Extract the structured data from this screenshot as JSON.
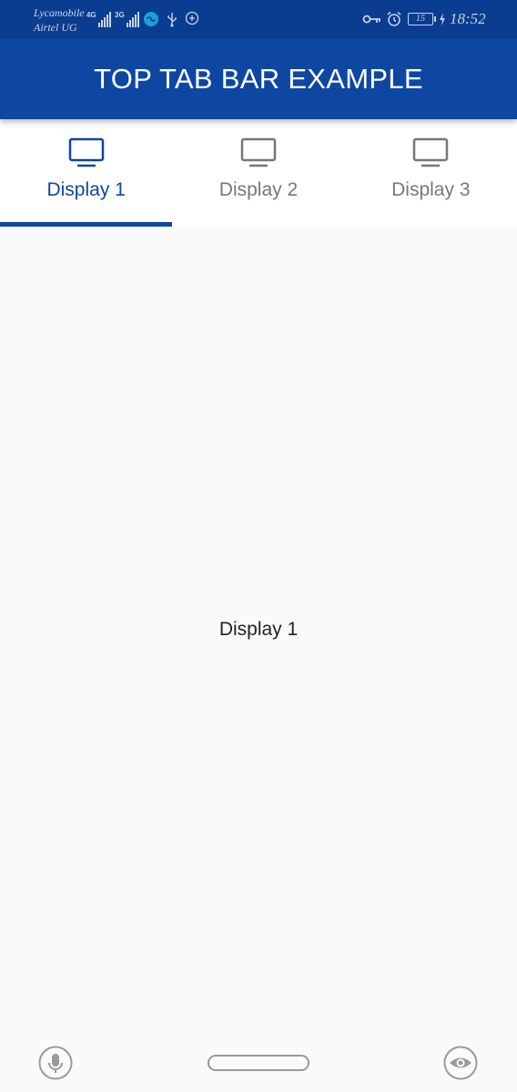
{
  "status_bar": {
    "carrier_1": "Lycamobile",
    "carrier_2": "Airtel UG",
    "network_1": "4G",
    "network_2": "3G",
    "battery_level": "15",
    "time": "18:52",
    "icons": [
      "signal-icon",
      "signal-icon",
      "data-saver-icon",
      "usb-icon",
      "location-icon",
      "vpn-key-icon",
      "alarm-icon",
      "battery-icon",
      "charging-icon"
    ]
  },
  "app_bar": {
    "title": "TOP TAB BAR EXAMPLE"
  },
  "tabs": [
    {
      "label": "Display 1",
      "icon": "tv-icon",
      "active": true
    },
    {
      "label": "Display 2",
      "icon": "tv-icon",
      "active": false
    },
    {
      "label": "Display 3",
      "icon": "tv-icon",
      "active": false
    }
  ],
  "content": {
    "text": "Display 1"
  },
  "nav_bar": {
    "icons": [
      "mic-icon",
      "home-pill",
      "eye-icon"
    ]
  },
  "colors": {
    "primary": "#0d47a1",
    "status_bar": "#0a3d8f",
    "inactive_tab": "#777777",
    "background": "#fafafa"
  }
}
